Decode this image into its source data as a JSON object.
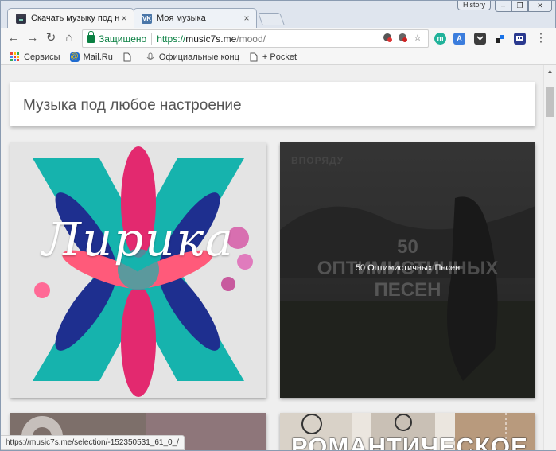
{
  "window": {
    "history_label": "History",
    "minimize_glyph": "‒",
    "restore_glyph": "❐",
    "close_glyph": "✕"
  },
  "tabs": [
    {
      "title": "Скачать музыку под нас",
      "icon": "music7s-cat-icon",
      "active": true
    },
    {
      "title": "Моя музыка",
      "icon": "vk-icon",
      "active": false
    }
  ],
  "toolbar": {
    "back_glyph": "←",
    "forward_glyph": "→",
    "reload_glyph": "↻",
    "home_glyph": "⌂",
    "secure_label": "Защищено",
    "url_proto": "https://",
    "url_host": "music7s.me",
    "url_path": "/mood/",
    "menu_glyph": "⋮"
  },
  "bookmarks": [
    {
      "label": "Сервисы",
      "icon": "apps-icon"
    },
    {
      "label": "Mail.Ru",
      "icon": "mailru-icon"
    },
    {
      "label": "",
      "icon": "page-icon"
    },
    {
      "label": "Официальные конц",
      "icon": "mic-icon"
    },
    {
      "label": "+ Pocket",
      "icon": "page-icon"
    }
  ],
  "page": {
    "title": "Музыка под любое настроение",
    "cards": [
      {
        "label": "Лирика",
        "type": "image-text"
      },
      {
        "label": "50 Оптимистичных Песен",
        "brand": "ВПОРЯДУ",
        "big_line1": "50",
        "big_line2": "ОПТИМИСТИЧНЫХ",
        "big_line3": "ПЕСЕН"
      },
      {
        "label": ""
      },
      {
        "label": "РОМАНТИЧЕСКОЕ"
      }
    ]
  },
  "status": {
    "url": "https://music7s.me/selection/-152350531_61_0_/"
  },
  "colors": {
    "secure": "#0b8043",
    "vk": "#4a76a8",
    "teal": "#1bb5b0",
    "magenta": "#e0277a"
  }
}
